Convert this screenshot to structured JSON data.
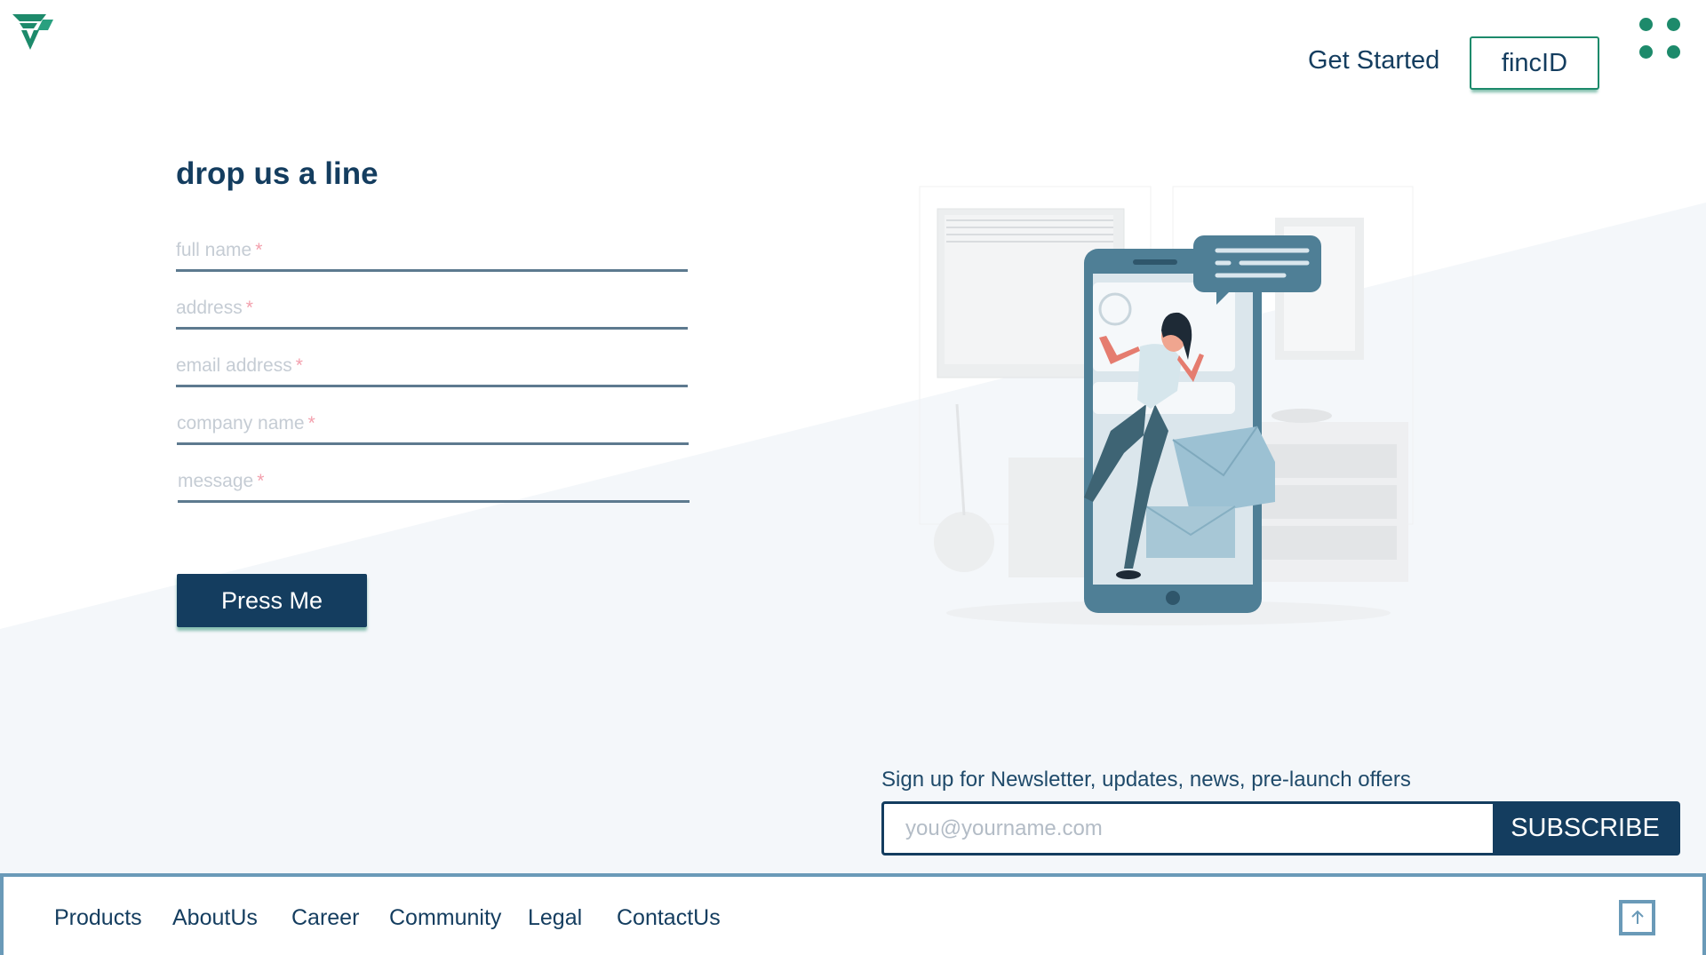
{
  "header": {
    "logo_icon": "fs-logo-icon",
    "get_started_label": "Get Started",
    "fincid_label": "fincID",
    "menu_icon": "grid-dots-icon"
  },
  "form": {
    "title": "drop us a line",
    "fields": [
      {
        "placeholder": "full name",
        "required_mark": "*"
      },
      {
        "placeholder": "address",
        "required_mark": "*"
      },
      {
        "placeholder": "email address",
        "required_mark": "*"
      },
      {
        "placeholder": "company name",
        "required_mark": "*"
      },
      {
        "placeholder": "message",
        "required_mark": "*"
      }
    ],
    "submit_label": "Press Me"
  },
  "newsletter": {
    "text": "Sign up for Newsletter, updates, news, pre-launch offers",
    "placeholder": "you@yourname.com",
    "button_label": "SUBSCRIBE"
  },
  "footer": {
    "links": [
      "Products",
      "AboutUs",
      "Career",
      "Community",
      "Legal",
      "ContactUs"
    ],
    "scroll_top_icon": "arrow-up-icon"
  },
  "colors": {
    "primary": "#143d5f",
    "accent": "#1d8a6b",
    "border": "#6a9ab8",
    "required": "#f3a0ad",
    "background_tint": "#f4f7fa"
  }
}
